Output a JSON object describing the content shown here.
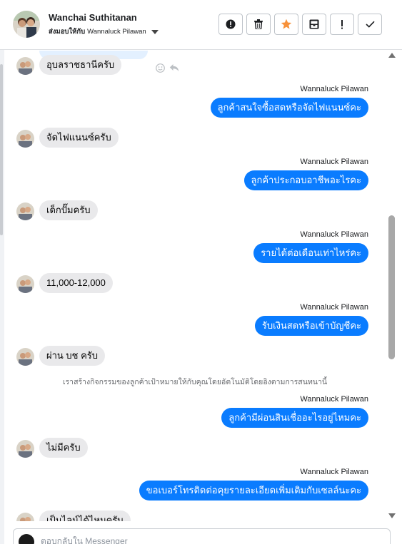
{
  "contact": {
    "name": "Wanchai Suthitanan",
    "assigned_label": "ส่งมอบให้กับ",
    "assigned_to": "Wannaluck Pilawan"
  },
  "actions": [
    {
      "name": "mark-spam-button",
      "icon": "alert-circle-icon"
    },
    {
      "name": "delete-button",
      "icon": "trash-icon"
    },
    {
      "name": "star-button",
      "icon": "star-icon",
      "color": "#f7923b"
    },
    {
      "name": "archive-button",
      "icon": "inbox-icon"
    },
    {
      "name": "mark-unread-button",
      "icon": "exclamation-icon"
    },
    {
      "name": "mark-done-button",
      "icon": "checkmark-icon"
    }
  ],
  "colors": {
    "outgoing_bubble": "#0a7cff",
    "incoming_bubble": "#e9e9eb",
    "star": "#f7923b"
  },
  "messages": {
    "m1": "อุบลราชธานีครับ",
    "m2_sender": "Wannaluck Pilawan",
    "m2": "ลูกค้าสนใจซื้อสดหรือจัดไฟแนนซ์คะ",
    "m3": "จัดไฟแนนซ์ครับ",
    "m4_sender": "Wannaluck Pilawan",
    "m4": "ลูกค้าประกอบอาชีพอะไรคะ",
    "m5": "เด็กปั๊มครับ",
    "m6_sender": "Wannaluck Pilawan",
    "m6": "รายได้ต่อเดือนเท่าไหร่คะ",
    "m7": "11,000-12,000",
    "m8_sender": "Wannaluck Pilawan",
    "m8": "รับเงินสดหรือเข้าบัญชีคะ",
    "m9": "ผ่าน บช ครับ",
    "system_note": "เราสร้างกิจกรรมของลูกค้าเป้าหมายให้กับคุณโดยอัตโนมัติโดยอิงตามการสนทนานี้",
    "m10_sender": "Wannaluck Pilawan",
    "m10": "ลูกค้ามีผ่อนสินเชื่ออะไรอยู่ไหมคะ",
    "m11": "ไม่มีครับ",
    "m12_sender": "Wannaluck Pilawan",
    "m12": "ขอเบอร์โทรติดต่อคุยรายละเอียดเพิ่มเติมกับเซลล์นะคะ",
    "m13": "เป็นไลน์ได้ไหมครับ"
  },
  "composer": {
    "placeholder": "ตอบกลับใน Messenger"
  }
}
